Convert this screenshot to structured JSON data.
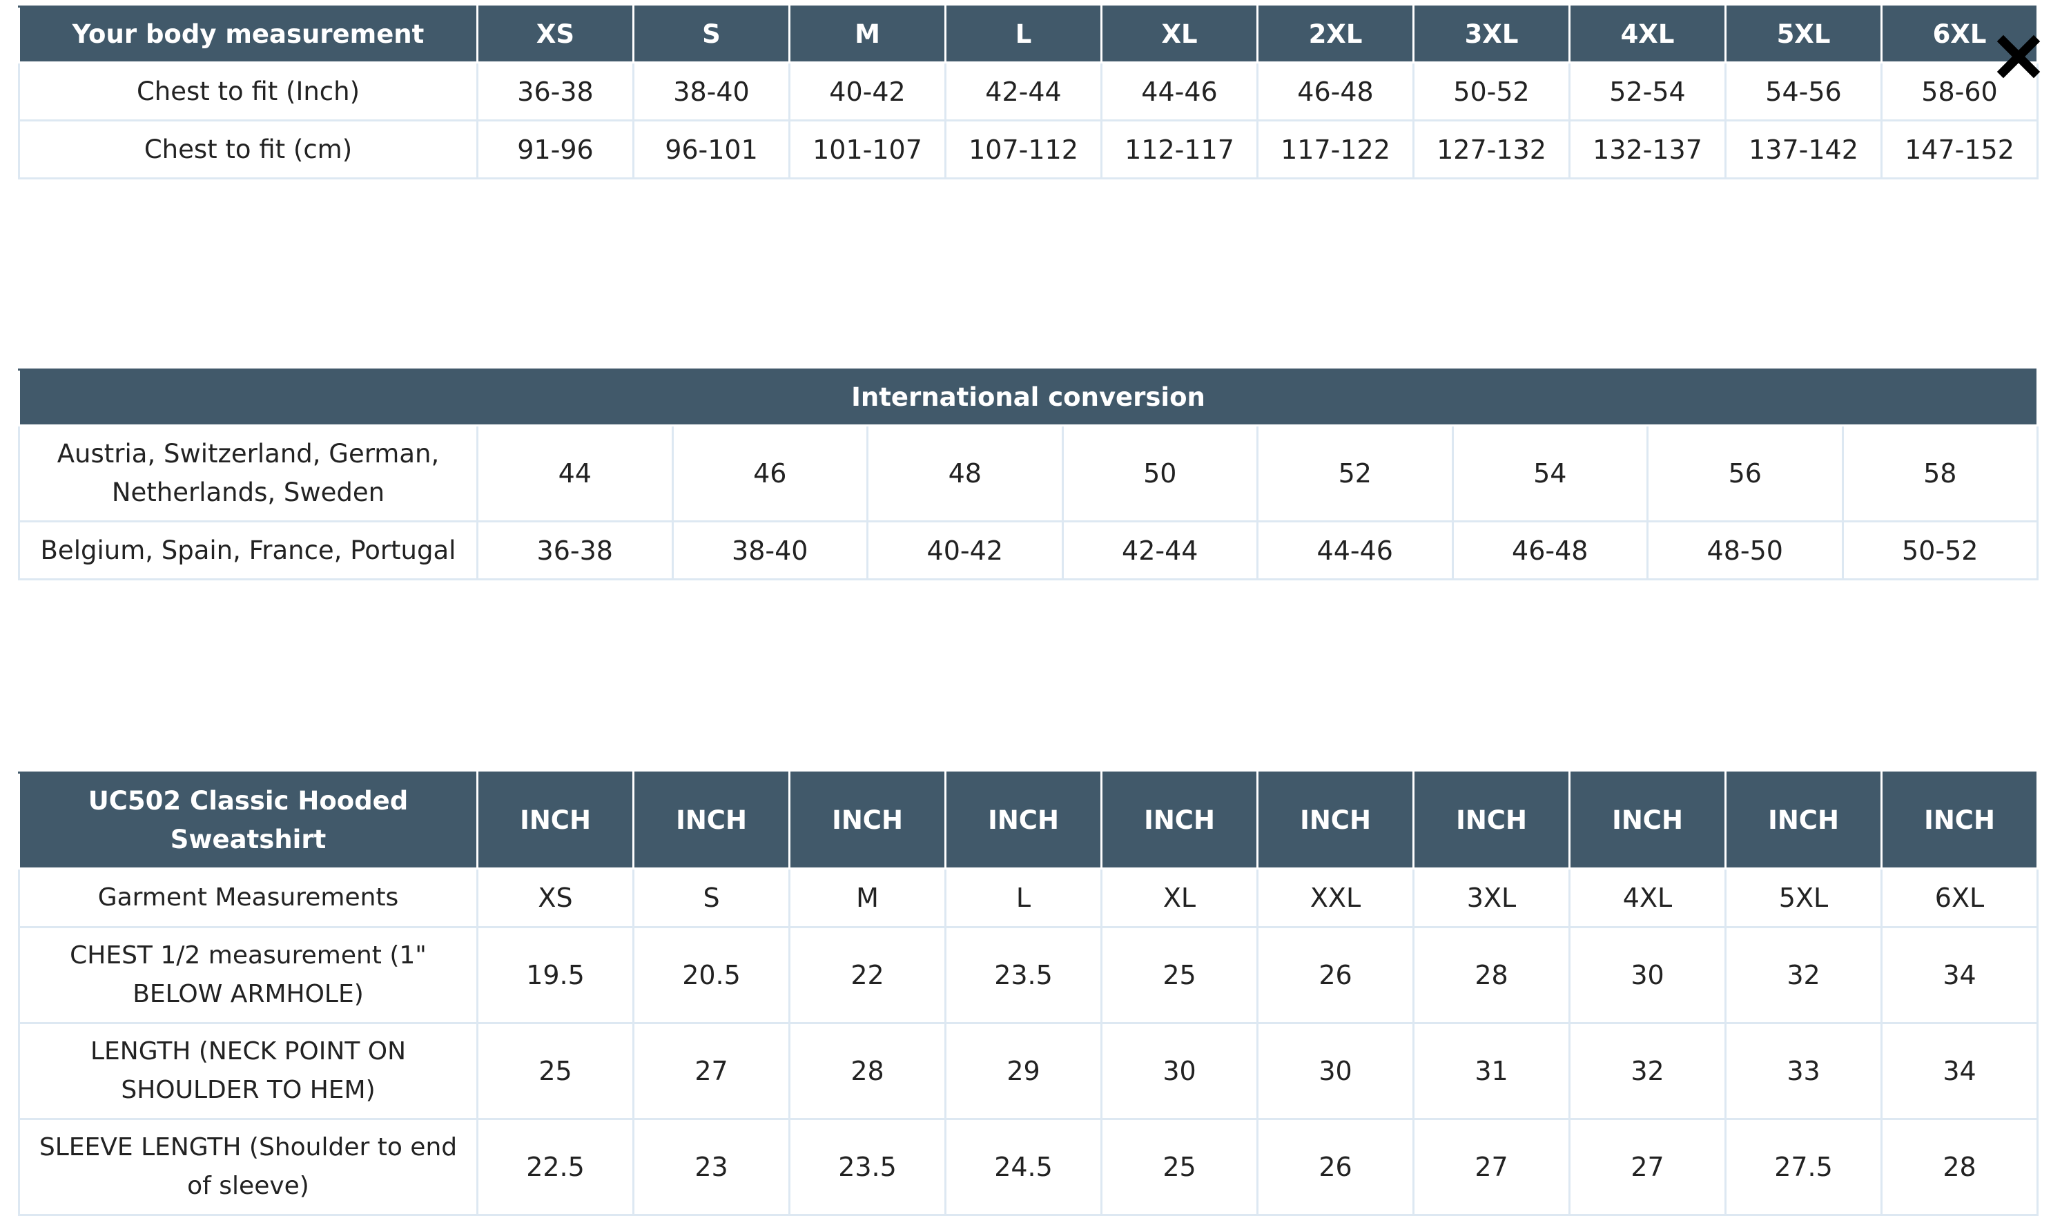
{
  "size_chart": {
    "header_label": "Your body measurement",
    "sizes": [
      "XS",
      "S",
      "M",
      "L",
      "XL",
      "2XL",
      "3XL",
      "4XL",
      "5XL",
      "6XL"
    ],
    "rows": [
      {
        "label": "Chest to fit (Inch)",
        "values": [
          "36-38",
          "38-40",
          "40-42",
          "42-44",
          "44-46",
          "46-48",
          "50-52",
          "52-54",
          "54-56",
          "58-60"
        ]
      },
      {
        "label": "Chest to fit (cm)",
        "values": [
          "91-96",
          "96-101",
          "101-107",
          "107-112",
          "112-117",
          "117-122",
          "127-132",
          "132-137",
          "137-142",
          "147-152"
        ]
      }
    ]
  },
  "international_conversion": {
    "title": "International conversion",
    "rows": [
      {
        "label": "Austria, Switzerland, German, Netherlands, Sweden",
        "values": [
          "44",
          "46",
          "48",
          "50",
          "52",
          "54",
          "56",
          "58"
        ]
      },
      {
        "label": "Belgium, Spain, France, Portugal",
        "values": [
          "36-38",
          "38-40",
          "40-42",
          "42-44",
          "44-46",
          "46-48",
          "48-50",
          "50-52"
        ]
      }
    ]
  },
  "garment_table": {
    "product_title": "UC502 Classic Hooded Sweatshirt",
    "unit_headers": [
      "INCH",
      "INCH",
      "INCH",
      "INCH",
      "INCH",
      "INCH",
      "INCH",
      "INCH",
      "INCH",
      "INCH"
    ],
    "rows": [
      {
        "label": "Garment Measurements",
        "values": [
          "XS",
          "S",
          "M",
          "L",
          "XL",
          "XXL",
          "3XL",
          "4XL",
          "5XL",
          "6XL"
        ]
      },
      {
        "label": "CHEST 1/2 measurement (1\" BELOW ARMHOLE)",
        "values": [
          "19.5",
          "20.5",
          "22",
          "23.5",
          "25",
          "26",
          "28",
          "30",
          "32",
          "34"
        ]
      },
      {
        "label": "LENGTH (NECK POINT ON SHOULDER TO HEM)",
        "values": [
          "25",
          "27",
          "28",
          "29",
          "30",
          "30",
          "31",
          "32",
          "33",
          "34"
        ]
      },
      {
        "label": "SLEEVE LENGTH (Shoulder to end of sleeve)",
        "values": [
          "22.5",
          "23",
          "23.5",
          "24.5",
          "25",
          "26",
          "27",
          "27",
          "27.5",
          "28"
        ]
      }
    ]
  },
  "close_button": {
    "icon": "close-icon"
  },
  "colors": {
    "header_bg": "#41596a",
    "header_text": "#ffffff",
    "cell_border": "#dde8f2",
    "body_text": "#222222"
  }
}
